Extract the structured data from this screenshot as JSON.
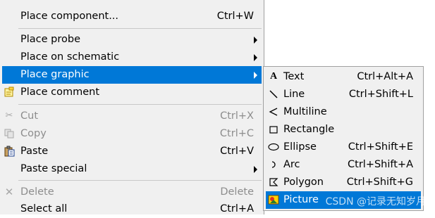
{
  "main_menu": {
    "items": [
      {
        "label": "Place component...",
        "shortcut": "Ctrl+W"
      },
      {
        "label": "Place probe"
      },
      {
        "label": "Place on schematic"
      },
      {
        "label": "Place graphic"
      },
      {
        "label": "Place comment"
      },
      {
        "label": "Cut",
        "shortcut": "Ctrl+X"
      },
      {
        "label": "Copy",
        "shortcut": "Ctrl+C"
      },
      {
        "label": "Paste",
        "shortcut": "Ctrl+V"
      },
      {
        "label": "Paste special"
      },
      {
        "label": "Delete",
        "shortcut": "Delete"
      },
      {
        "label": "Select all",
        "shortcut": "Ctrl+A"
      }
    ]
  },
  "sub_menu": {
    "items": [
      {
        "label": "Text",
        "shortcut": "Ctrl+Alt+A",
        "icon": "text-icon"
      },
      {
        "label": "Line",
        "shortcut": "Ctrl+Shift+L",
        "icon": "line-icon"
      },
      {
        "label": "Multiline",
        "icon": "multiline-icon"
      },
      {
        "label": "Rectangle",
        "icon": "rectangle-icon"
      },
      {
        "label": "Ellipse",
        "shortcut": "Ctrl+Shift+E",
        "icon": "ellipse-icon"
      },
      {
        "label": "Arc",
        "shortcut": "Ctrl+Shift+A",
        "icon": "arc-icon"
      },
      {
        "label": "Polygon",
        "shortcut": "Ctrl+Shift+G",
        "icon": "polygon-icon"
      },
      {
        "label": "Picture",
        "icon": "picture-icon"
      }
    ]
  },
  "watermark": "CSDN @记录无知岁月",
  "colors": {
    "highlight": "#0078d7",
    "menu_background": "#f0f0f0",
    "disabled_text": "#8d8d8d"
  }
}
